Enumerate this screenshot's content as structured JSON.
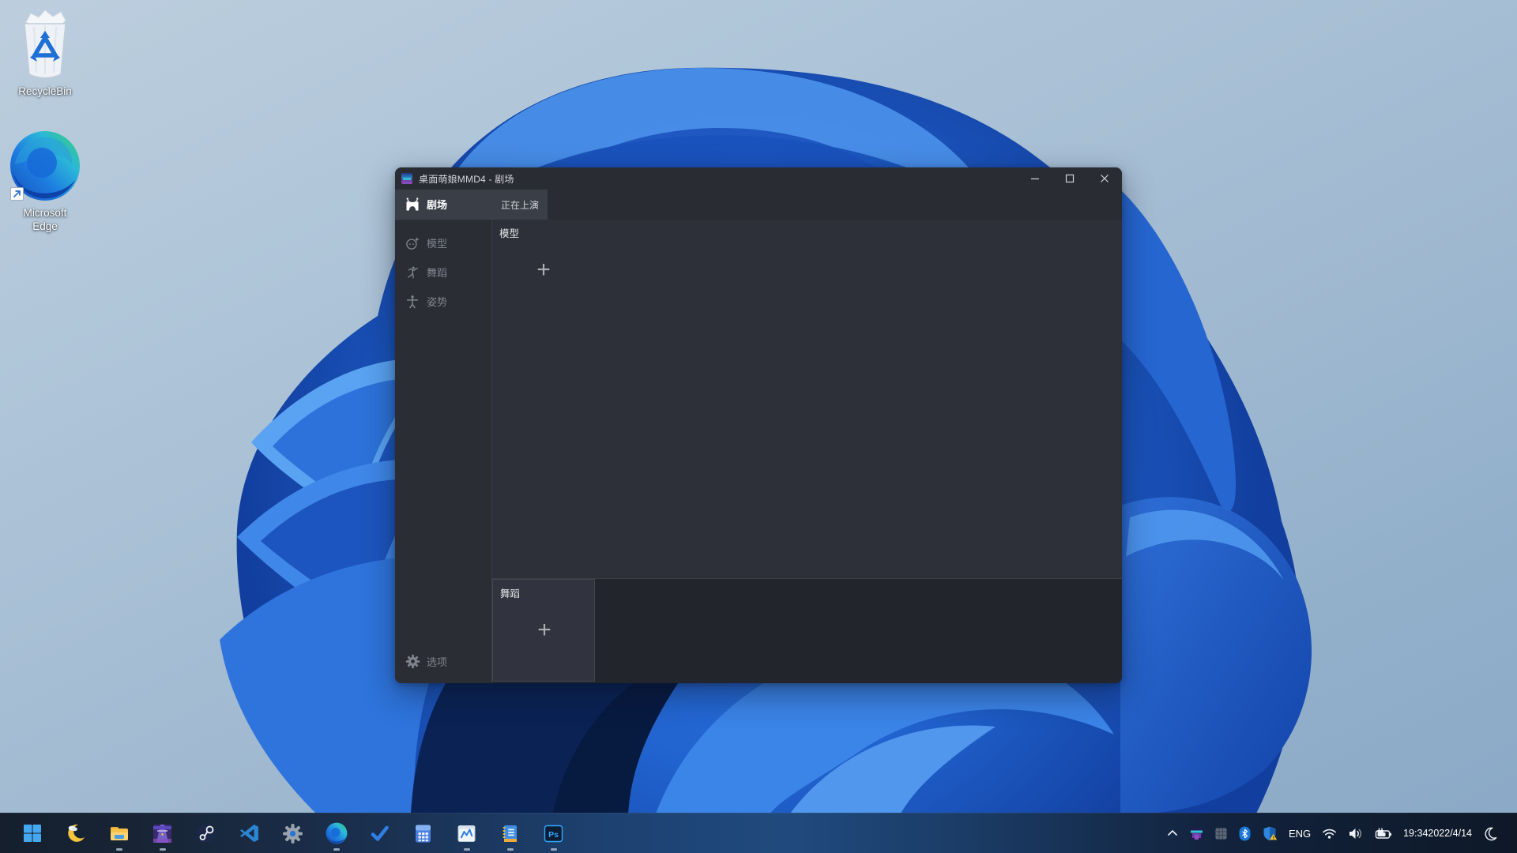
{
  "desktop_icons": [
    {
      "name": "recycle-bin",
      "label": "RecycleBin"
    },
    {
      "name": "microsoft-edge",
      "label": "Microsoft Edge",
      "label_line1": "Microsoft",
      "label_line2": "Edge"
    }
  ],
  "window": {
    "title": "桌面萌娘MMD4 - 剧场",
    "controls": [
      {
        "name": "minimize"
      },
      {
        "name": "maximize"
      },
      {
        "name": "close"
      }
    ],
    "sidebar": {
      "items": [
        {
          "label": "剧场",
          "icon": "theater-stage-icon",
          "active": true
        },
        {
          "label": "模型",
          "icon": "model-face-icon",
          "active": false
        },
        {
          "label": "舞蹈",
          "icon": "dance-figure-icon",
          "active": false
        },
        {
          "label": "姿势",
          "icon": "pose-figure-icon",
          "active": false
        }
      ],
      "footer": {
        "label": "选项",
        "icon": "gear-icon"
      }
    },
    "tabs": [
      {
        "label": "正在上演",
        "active": true
      }
    ],
    "model_section": {
      "title": "模型",
      "add_button": "+"
    },
    "dance_section": {
      "title": "舞蹈",
      "add_button": "+"
    },
    "colors": {
      "titlebar_bg": "#2a2c34",
      "sidebar_bg": "#2b2d35",
      "selected_bg": "#3a3e47",
      "content_bg": "#2d3038",
      "bottom_bg": "#23252d",
      "card_bg": "#31343e",
      "card_border": "#42464f",
      "text_bright": "#e7e8ea",
      "text_dim": "#7f838d"
    }
  },
  "taskbar": {
    "apps": [
      {
        "name": "start",
        "running": false
      },
      {
        "name": "widgets-weather",
        "running": false
      },
      {
        "name": "file-explorer",
        "running": true
      },
      {
        "name": "mmd-app",
        "running": true
      },
      {
        "name": "steam",
        "running": false
      },
      {
        "name": "vscode",
        "running": false
      },
      {
        "name": "settings",
        "running": false
      },
      {
        "name": "edge",
        "running": true
      },
      {
        "name": "todo-check",
        "running": false
      },
      {
        "name": "calculator",
        "running": false
      },
      {
        "name": "performance-chart",
        "running": true
      },
      {
        "name": "notepad",
        "running": true
      },
      {
        "name": "photoshop",
        "running": true
      }
    ],
    "tray": {
      "language": "ENG",
      "time": "19:34",
      "date": "2022/4/14"
    }
  }
}
